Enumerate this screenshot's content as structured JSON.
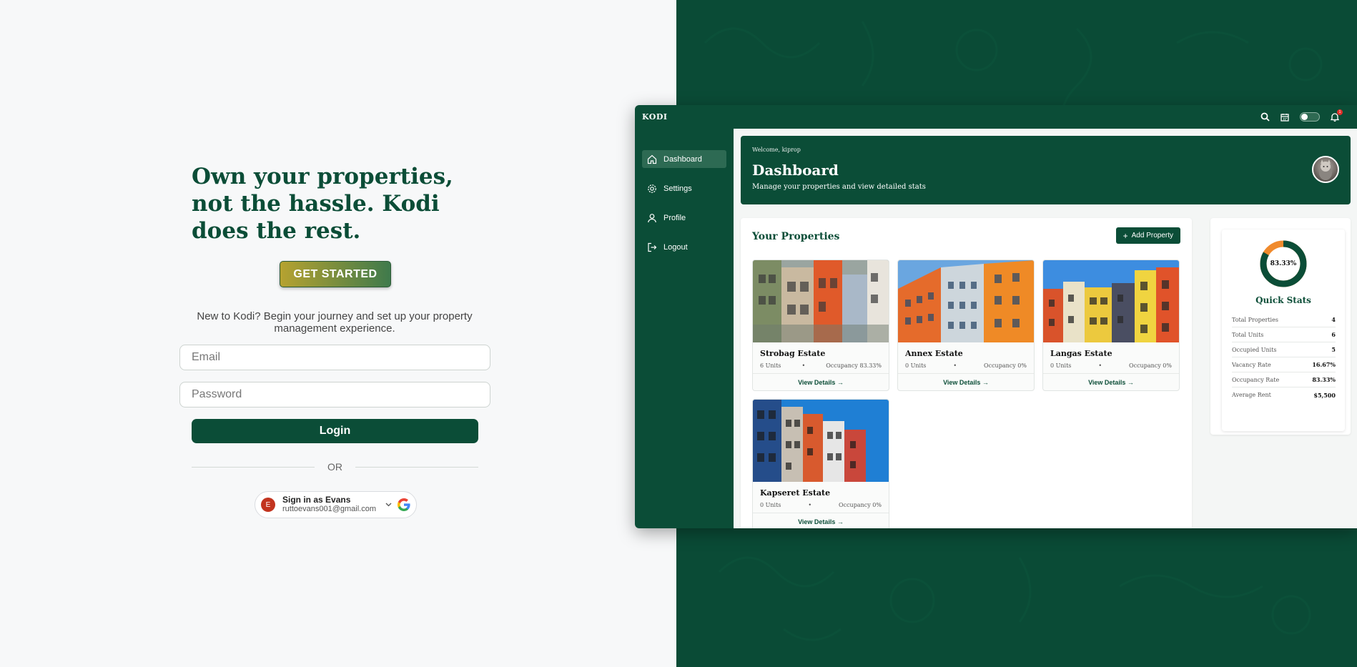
{
  "landing": {
    "headline": "Own your properties, not the hassle. Kodi does the rest.",
    "get_started": "GET STARTED",
    "intro": "New to Kodi? Begin your journey and set up your property management experience.",
    "email_placeholder": "Email",
    "password_placeholder": "Password",
    "login_label": "Login",
    "or_label": "OR",
    "google": {
      "avatar_initial": "E",
      "name": "Sign in as Evans",
      "email": "ruttoevans001@gmail.com"
    }
  },
  "app": {
    "brand": "KODI",
    "notification_count": "1",
    "sidebar": {
      "items": [
        {
          "label": "Dashboard",
          "icon": "home-icon",
          "active": true
        },
        {
          "label": "Settings",
          "icon": "gear-icon",
          "active": false
        },
        {
          "label": "Profile",
          "icon": "user-icon",
          "active": false
        },
        {
          "label": "Logout",
          "icon": "logout-icon",
          "active": false
        }
      ]
    },
    "hero": {
      "welcome": "Welcome, kiprop",
      "title": "Dashboard",
      "subtitle": "Manage your properties and view detailed stats"
    },
    "properties": {
      "title": "Your Properties",
      "add_label": "Add Property",
      "cards": [
        {
          "name": "Strobag Estate",
          "units": "6 Units",
          "occupancy": "Occupancy 83.33%",
          "link": "View Details →"
        },
        {
          "name": "Annex Estate",
          "units": "0 Units",
          "occupancy": "Occupancy 0%",
          "link": "View Details →"
        },
        {
          "name": "Langas Estate",
          "units": "0 Units",
          "occupancy": "Occupancy 0%",
          "link": "View Details →"
        },
        {
          "name": "Kapseret Estate",
          "units": "0 Units",
          "occupancy": "Occupancy 0%",
          "link": "View Details →"
        }
      ],
      "separator": "•"
    },
    "stats": {
      "donut_label": "83.33%",
      "donut_fraction": 0.8333,
      "title": "Quick Stats",
      "rows": [
        {
          "label": "Total Properties",
          "value": "4"
        },
        {
          "label": "Total Units",
          "value": "6"
        },
        {
          "label": "Occupied Units",
          "value": "5"
        },
        {
          "label": "Vacancy Rate",
          "value": "16.67%"
        },
        {
          "label": "Occupancy Rate",
          "value": "83.33%"
        },
        {
          "label": "Average Rent",
          "value": "$5,500"
        }
      ]
    }
  },
  "colors": {
    "brand_green": "#0b4d37",
    "accent_orange": "#f08a2c",
    "gold": "#b6a230"
  }
}
